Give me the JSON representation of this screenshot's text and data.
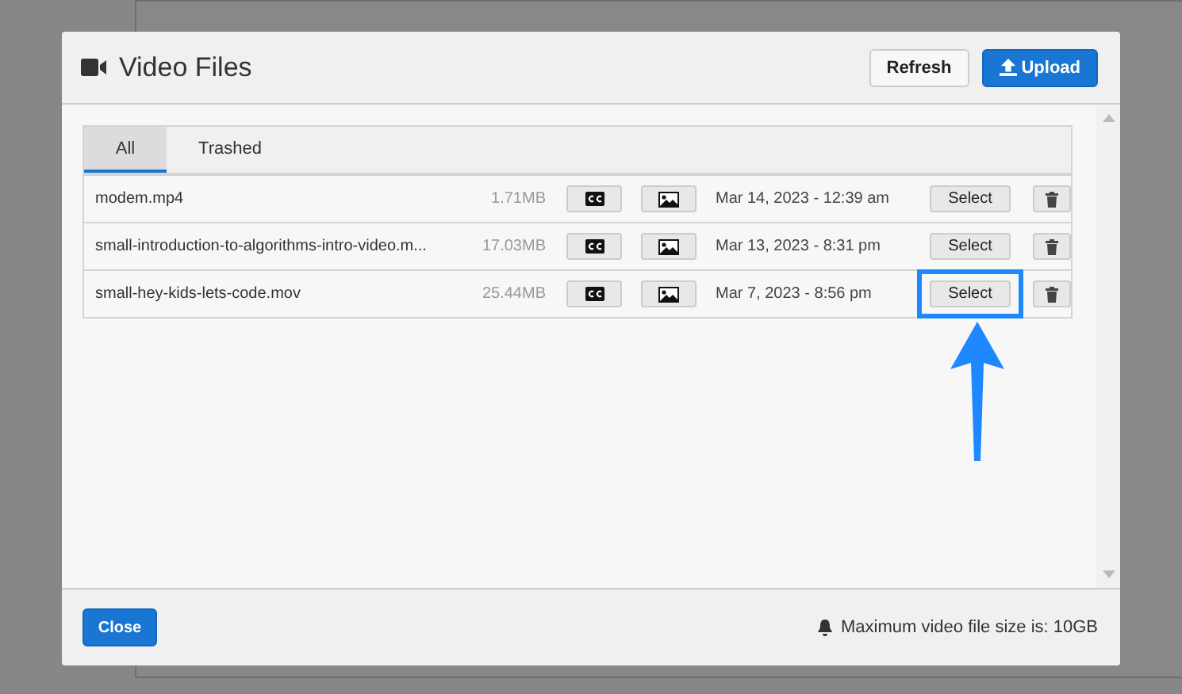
{
  "dialog": {
    "title": "Video Files",
    "header_buttons": [
      {
        "label": "Refresh",
        "kind": "secondary"
      },
      {
        "label": "Upload",
        "kind": "primary"
      }
    ]
  },
  "tabs": [
    {
      "label": "All",
      "selected": true
    },
    {
      "label": "Trashed",
      "selected": false
    }
  ],
  "files": [
    {
      "name": "modem.mp4",
      "size": "1.71MB",
      "date": "Mar 14, 2023 - 12:39 am",
      "select_label": "Select",
      "highlighted": false
    },
    {
      "name": "small-introduction-to-algorithms-intro-video.m...",
      "size": "17.03MB",
      "date": "Mar 13, 2023 - 8:31 pm",
      "select_label": "Select",
      "highlighted": false
    },
    {
      "name": "small-hey-kids-lets-code.mov",
      "size": "25.44MB",
      "date": "Mar 7, 2023 - 8:56 pm",
      "select_label": "Select",
      "highlighted": true
    }
  ],
  "footer": {
    "close_label": "Close",
    "note": "Maximum video file size is: 10GB"
  }
}
